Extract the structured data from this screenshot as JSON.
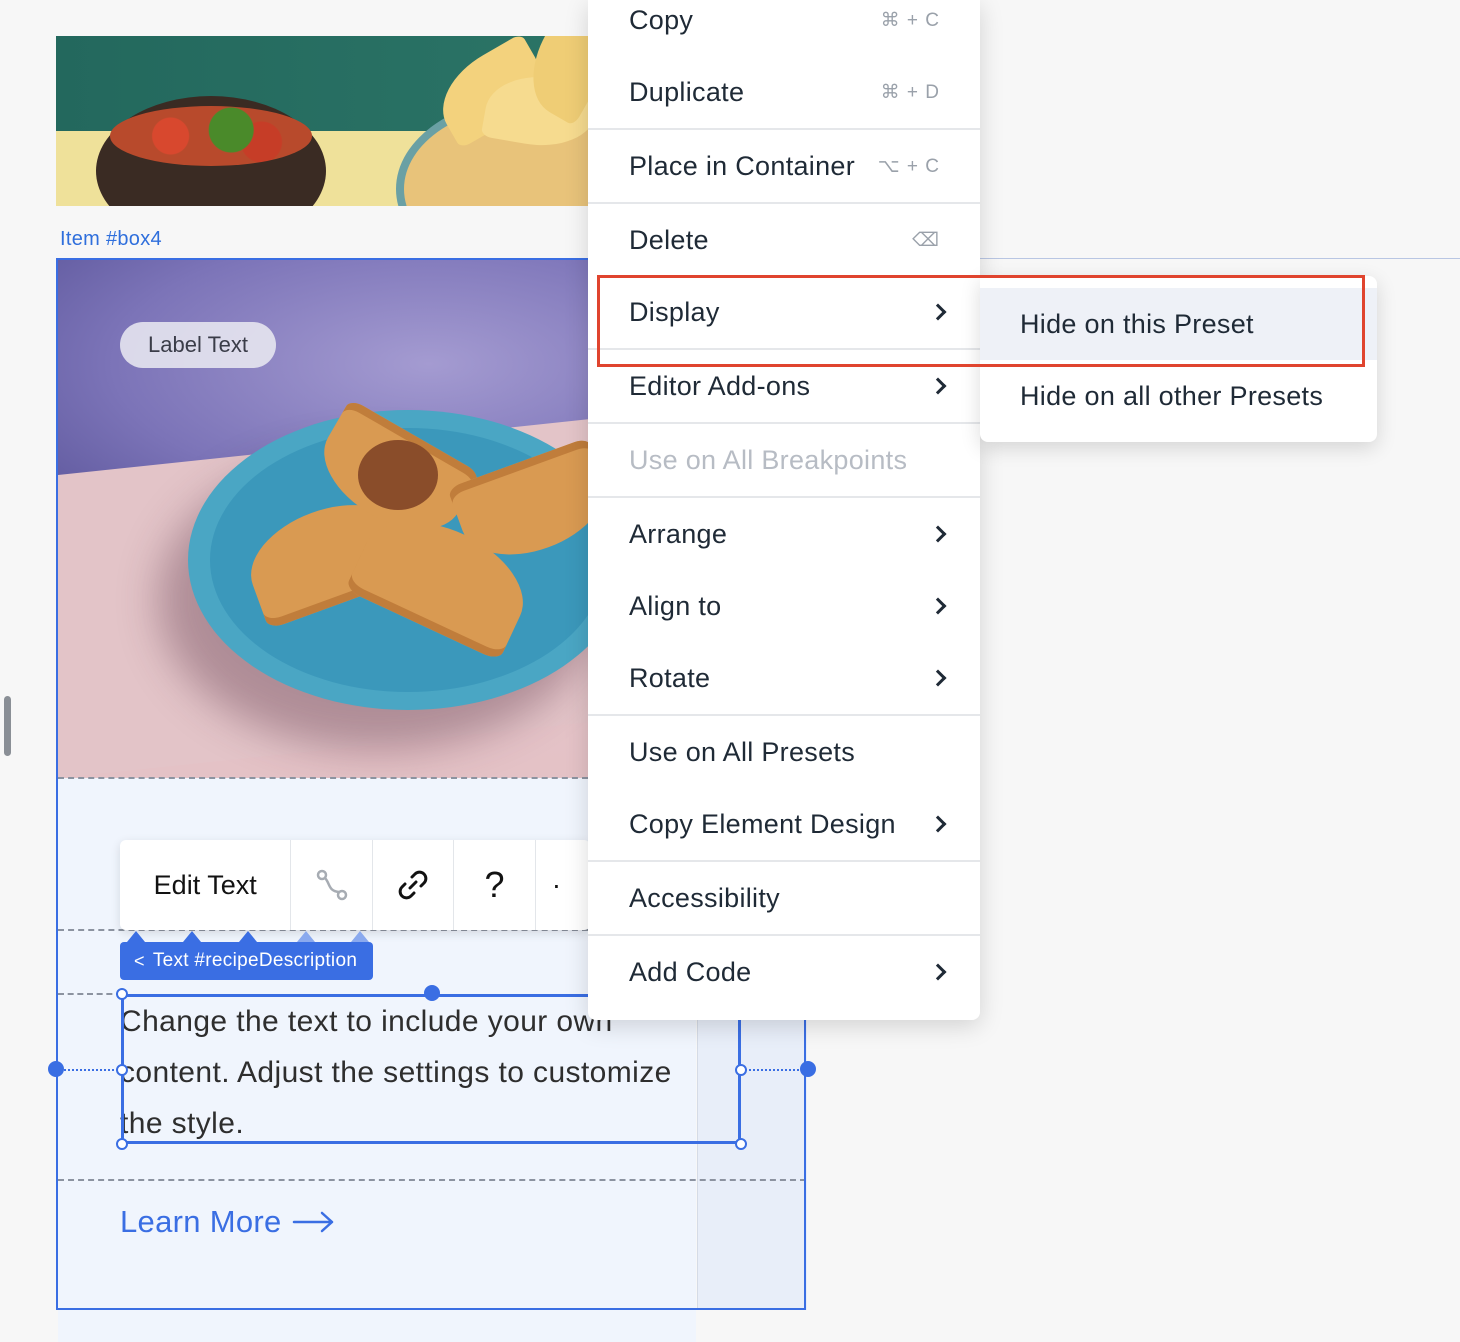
{
  "canvas": {
    "item_label": "Item #box4",
    "label_chip": "Label Text",
    "toolbar": {
      "edit_text": "Edit Text",
      "help_glyph": "?",
      "more_glyph": "·"
    },
    "text_tag": "Text #recipeDescription",
    "body_text": "Change the text to include your own content. Adjust the settings to customize the style.",
    "learn_more": "Learn More"
  },
  "context_menu": {
    "items": [
      {
        "label": "Copy",
        "shortcut": "⌘ + C"
      },
      {
        "label": "Duplicate",
        "shortcut": "⌘ + D"
      },
      {
        "label": "Place in Container",
        "shortcut": "⌥ + C"
      },
      {
        "label": "Delete",
        "shortcut": "⌫"
      },
      {
        "label": "Display",
        "has_submenu": true
      },
      {
        "label": "Editor Add-ons",
        "has_submenu": true
      },
      {
        "label": "Use on All Breakpoints",
        "disabled": true
      },
      {
        "label": "Arrange",
        "has_submenu": true
      },
      {
        "label": "Align to",
        "has_submenu": true
      },
      {
        "label": "Rotate",
        "has_submenu": true
      },
      {
        "label": "Use on All Presets"
      },
      {
        "label": "Copy Element Design",
        "has_submenu": true
      },
      {
        "label": "Accessibility"
      },
      {
        "label": "Add Code",
        "has_submenu": true
      }
    ]
  },
  "submenu": {
    "items": [
      {
        "label": "Hide on this Preset"
      },
      {
        "label": "Hide on all other Presets"
      }
    ]
  },
  "colors": {
    "accent": "#3a6ee3",
    "highlight": "#e0442e"
  }
}
